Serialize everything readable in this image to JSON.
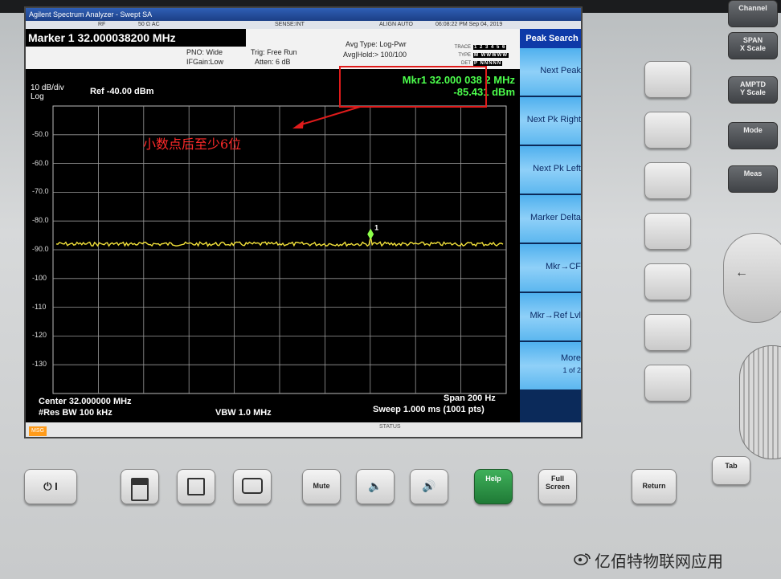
{
  "instrument": {
    "title": "Agilent Spectrum Analyzer - Swept SA",
    "status_strip": {
      "rf": "RF",
      "ohm": "50 Ω  AC",
      "sense": "SENSE:INT",
      "align": "ALIGN AUTO",
      "datetime": "06:08:22 PM Sep 04, 2019"
    },
    "marker_title": "Marker 1 32.000038200 MHz",
    "settings": {
      "pno": "PNO: Wide",
      "ifgain": "IFGain:Low",
      "trig": "Trig: Free Run",
      "atten": "Atten: 6 dB",
      "avg_type": "Avg Type: Log-Pwr",
      "avg_hold": "Avg|Hold:> 100/100"
    },
    "trace_box": {
      "trace_label": "TRACE",
      "trace_vals": "1 2 3 4 5 6",
      "type_label": "TYPE",
      "type_vals": "M WWWWW",
      "det_label": "DET",
      "det_vals": "P NNNNN"
    }
  },
  "plot": {
    "scale_div": "10 dB/div",
    "scale_log": "Log",
    "ref_level": "Ref -40.00 dBm",
    "y_ticks": [
      "-50.0",
      "-60.0",
      "-70.0",
      "-80.0",
      "-90.0",
      "-100",
      "-110",
      "-120",
      "-130"
    ],
    "marker_readout": {
      "line1": "Mkr1 32.000 038 2 MHz",
      "line2": "-85.431 dBm"
    },
    "marker_label": "1",
    "annotation": "小数点后至少6位",
    "center": "Center 32.000000 MHz",
    "res_bw": "#Res BW 100 kHz",
    "vbw": "VBW 1.0 MHz",
    "span": "Span 200 Hz",
    "sweep": "Sweep  1.000 ms (1001 pts)",
    "trace_color": "#f2e13a",
    "noise_floor_dbm": -88,
    "marker_peak_dbm": -85.431
  },
  "msgbar": {
    "msg": "MSG",
    "status": "STATUS"
  },
  "softkeys": {
    "title": "Peak Search",
    "items": [
      {
        "label": "Next Peak"
      },
      {
        "label": "Next Pk Right"
      },
      {
        "label": "Next Pk Left"
      },
      {
        "label": "Marker Delta"
      },
      {
        "label": "Mkr→CF"
      },
      {
        "label": "Mkr→Ref Lvl"
      },
      {
        "label": "More",
        "sub": "1 of 2"
      }
    ]
  },
  "right_buttons": [
    {
      "label": "Channel"
    },
    {
      "label": "SPAN\nX Scale"
    },
    {
      "label": "AMPTD\nY Scale"
    },
    {
      "label": "Mode"
    },
    {
      "label": "Meas"
    }
  ],
  "front_buttons": {
    "power": "⏻ I",
    "mute": "Mute",
    "help": "Help",
    "full_screen": "Full\nScreen",
    "return": "Return",
    "tab": "Tab"
  },
  "watermark": "亿佰特物联网应用"
}
